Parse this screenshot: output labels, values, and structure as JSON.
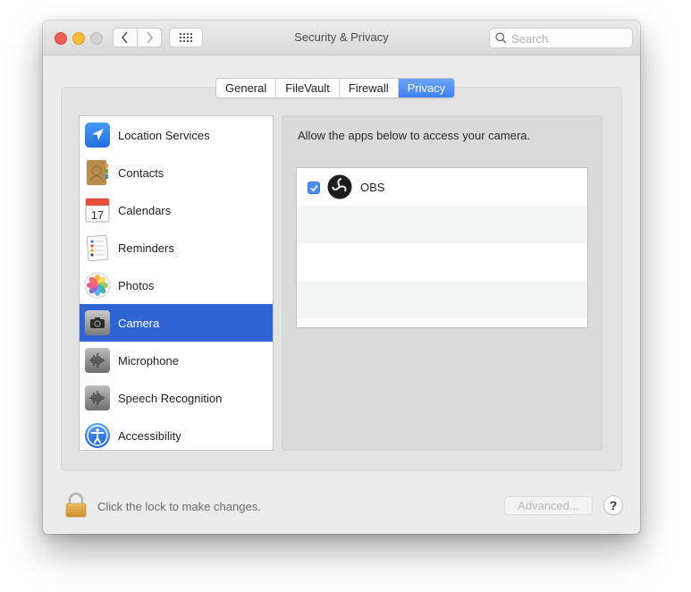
{
  "window": {
    "title": "Security & Privacy",
    "search_placeholder": "Search",
    "search_value": ""
  },
  "toolbar": {
    "back_icon": "chevron-left-icon",
    "forward_icon": "chevron-right-icon",
    "show_all_icon": "grid-icon"
  },
  "tabs": [
    {
      "label": "General",
      "active": false
    },
    {
      "label": "FileVault",
      "active": false
    },
    {
      "label": "Firewall",
      "active": false
    },
    {
      "label": "Privacy",
      "active": true
    }
  ],
  "sidebar": {
    "items": [
      {
        "label": "Location Services",
        "icon": "location-arrow-icon",
        "selected": false
      },
      {
        "label": "Contacts",
        "icon": "contacts-book-icon",
        "selected": false
      },
      {
        "label": "Calendars",
        "icon": "calendar-icon",
        "icon_text": "17",
        "selected": false
      },
      {
        "label": "Reminders",
        "icon": "reminders-list-icon",
        "selected": false
      },
      {
        "label": "Photos",
        "icon": "photos-flower-icon",
        "selected": false
      },
      {
        "label": "Camera",
        "icon": "camera-icon",
        "selected": true
      },
      {
        "label": "Microphone",
        "icon": "waveform-icon",
        "selected": false
      },
      {
        "label": "Speech Recognition",
        "icon": "waveform-icon",
        "selected": false
      },
      {
        "label": "Accessibility",
        "icon": "accessibility-icon",
        "selected": false
      }
    ]
  },
  "detail": {
    "description": "Allow the apps below to access your camera.",
    "apps": [
      {
        "name": "OBS",
        "checked": true,
        "icon": "obs-icon"
      }
    ]
  },
  "footer": {
    "lock_text": "Click the lock to make changes.",
    "advanced_label": "Advanced...",
    "help_label": "?"
  },
  "colors": {
    "accent": "#3e80f2",
    "selection": "#2f64d4",
    "close": "#ee5e57",
    "minimize": "#f5be3b",
    "zoom_disabled": "#d2d2d2"
  }
}
